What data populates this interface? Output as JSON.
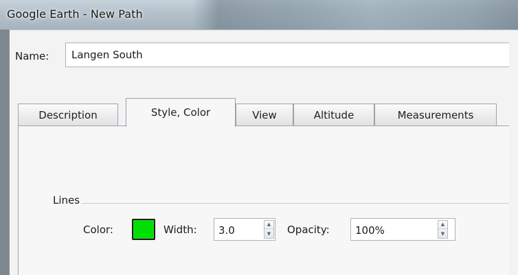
{
  "window": {
    "title": "Google Earth - New Path"
  },
  "name_field": {
    "label": "Name:",
    "value": "Langen South"
  },
  "tabs": [
    {
      "label": "Description",
      "active": false
    },
    {
      "label": "Style, Color",
      "active": true
    },
    {
      "label": "View",
      "active": false
    },
    {
      "label": "Altitude",
      "active": false
    },
    {
      "label": "Measurements",
      "active": false
    }
  ],
  "lines_group": {
    "title": "Lines",
    "color_label": "Color:",
    "color_value": "#00e000",
    "width_label": "Width:",
    "width_value": "3.0",
    "opacity_label": "Opacity:",
    "opacity_value": "100%"
  },
  "icons": {
    "spin_up": "spin-up-arrow-icon",
    "spin_down": "spin-down-arrow-icon"
  }
}
